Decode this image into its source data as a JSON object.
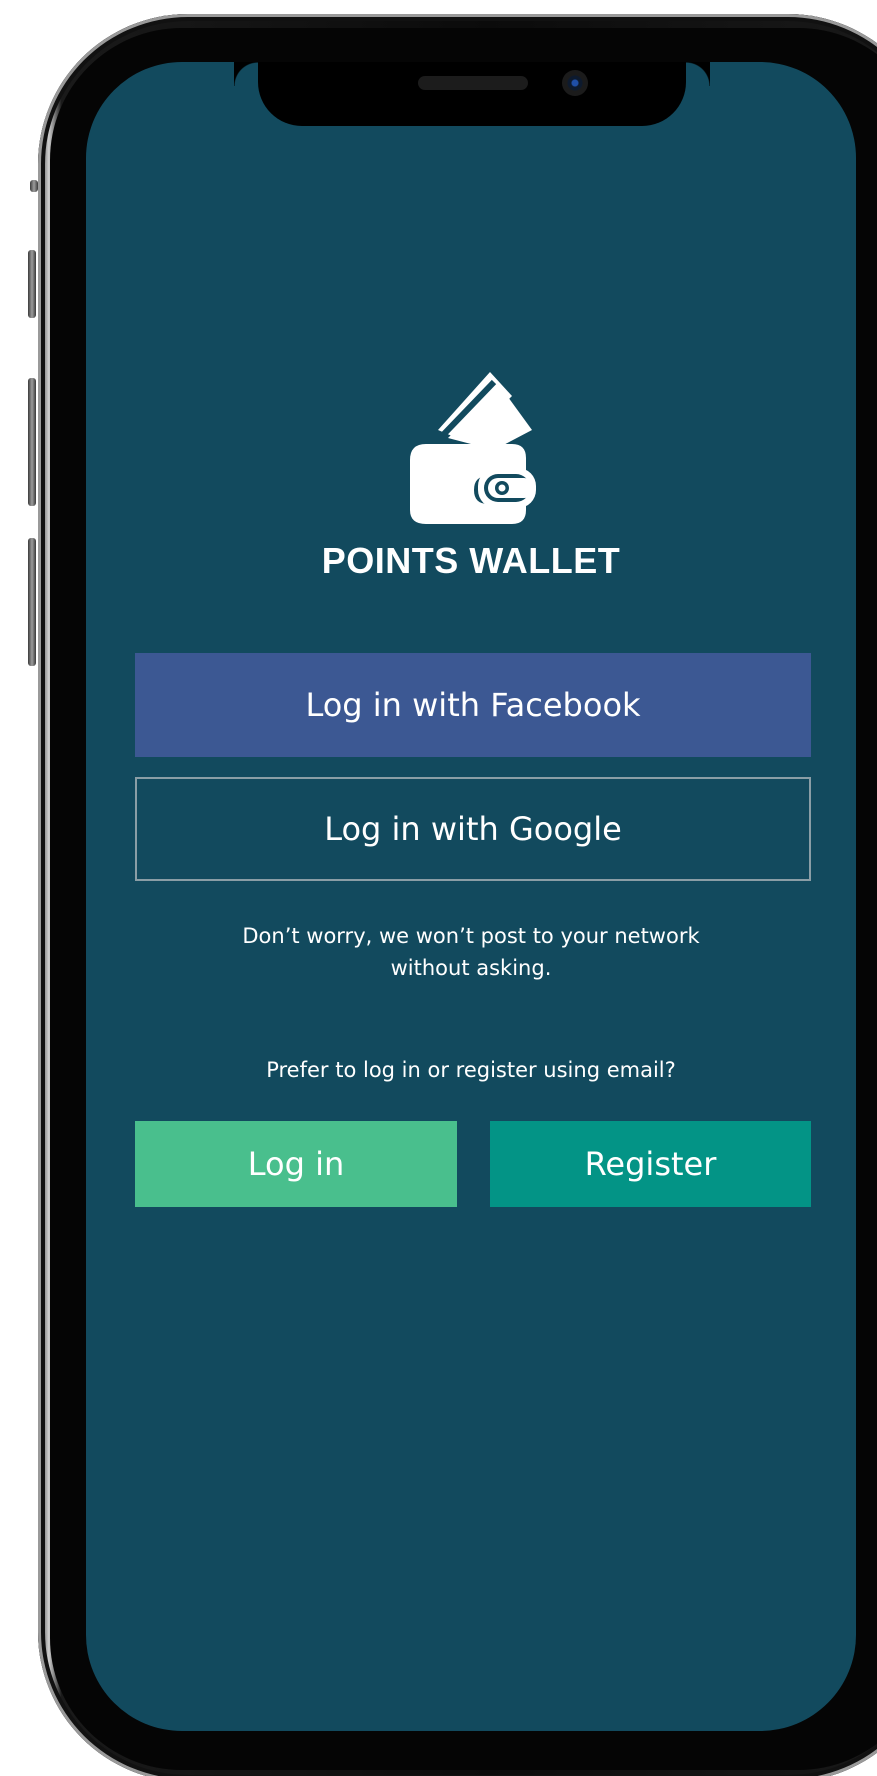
{
  "app": {
    "title": "POINTS WALLET",
    "logo_icon": "wallet-icon"
  },
  "social_login": {
    "facebook_label": "Log in with Facebook",
    "google_label": "Log in with Google",
    "notice_line1": "Don’t worry, we won’t post to your network",
    "notice_line2": "without asking."
  },
  "email_auth": {
    "prompt": "Prefer to log in or register using email?",
    "login_label": "Log in",
    "register_label": "Register"
  },
  "colors": {
    "background": "#124a5e",
    "facebook": "#3c5893",
    "login": "#49bf8d",
    "register": "#039486",
    "google_border": "#8a9ea6",
    "text": "#ffffff"
  }
}
